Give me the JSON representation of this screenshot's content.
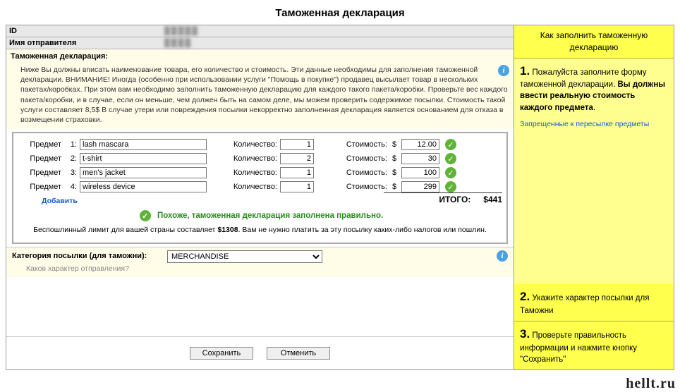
{
  "title": "Таможенная декларация",
  "header": {
    "id_label": "ID",
    "id_value": "█████",
    "sender_label": "Имя отправителя",
    "sender_value": "████"
  },
  "declaration": {
    "section_title": "Таможенная декларация:",
    "info_text": "Ниже Вы должны вписать наименование товара, его количество и стоимость. Эти данные необходимы для заполнения таможенной декларации. ВНИМАНИЕ! Иногда (особенно при использовании услуги \"Помощь в покупке\") продавец высылает товар в нескольких пакетах/коробках. При этом вам необходимо заполнить таможенную декларацию для каждого такого пакета/коробки. Проверьте вес каждого пакета/коробки, и в случае, если он меньше, чем должен быть на самом деле, мы можем проверить содержимое посылки. Стоимость такой услуги составляет 8,5$ В случае утери или повреждения посылки некорректно заполненная декларация является основанием для отказа в возмещении страховки.",
    "item_label": "Предмет",
    "qty_label": "Количество:",
    "cost_label": "Стоимость:",
    "dollar": "$",
    "items": [
      {
        "num": "1:",
        "name": "lash mascara",
        "qty": "1",
        "cost": "12.00"
      },
      {
        "num": "2:",
        "name": "t-shirt",
        "qty": "2",
        "cost": "30"
      },
      {
        "num": "3:",
        "name": "men's jacket",
        "qty": "1",
        "cost": "100"
      },
      {
        "num": "4:",
        "name": "wireless device",
        "qty": "1",
        "cost": "299"
      }
    ],
    "add_label": "Добавить",
    "total_label": "ИТОГО:",
    "total_value": "$441",
    "valid_msg": "Похоже, таможенная декларация заполнена правильно.",
    "limit_msg_1": "Беспошлинный лимит для вашей страны составляет ",
    "limit_amount": "$1308",
    "limit_msg_2": ". Вам не нужно платить за эту посылку каких-либо налогов или пошлин."
  },
  "category": {
    "label": "Категория посылки (для таможни):",
    "selected": "MERCHANDISE",
    "hint": "Каков характер отправления?"
  },
  "buttons": {
    "save": "Сохранить",
    "cancel": "Отменить"
  },
  "sidebar": {
    "header": "Как заполнить таможенную декларацию",
    "step1_num": "1.",
    "step1_text_a": " Пожалуйста заполните форму таможенной декларации. ",
    "step1_text_b": "Вы должны ввести реальную стоимость каждого предмета",
    "step1_forbidden": "Запрещенные к пересылке предметы",
    "step2_num": "2.",
    "step2_text": " Укажите характер посылки для Таможни",
    "step3_num": "3.",
    "step3_text": " Проверьте правильность информации и нажмите кнопку \"Сохранить\""
  },
  "watermark": "hellt.ru"
}
